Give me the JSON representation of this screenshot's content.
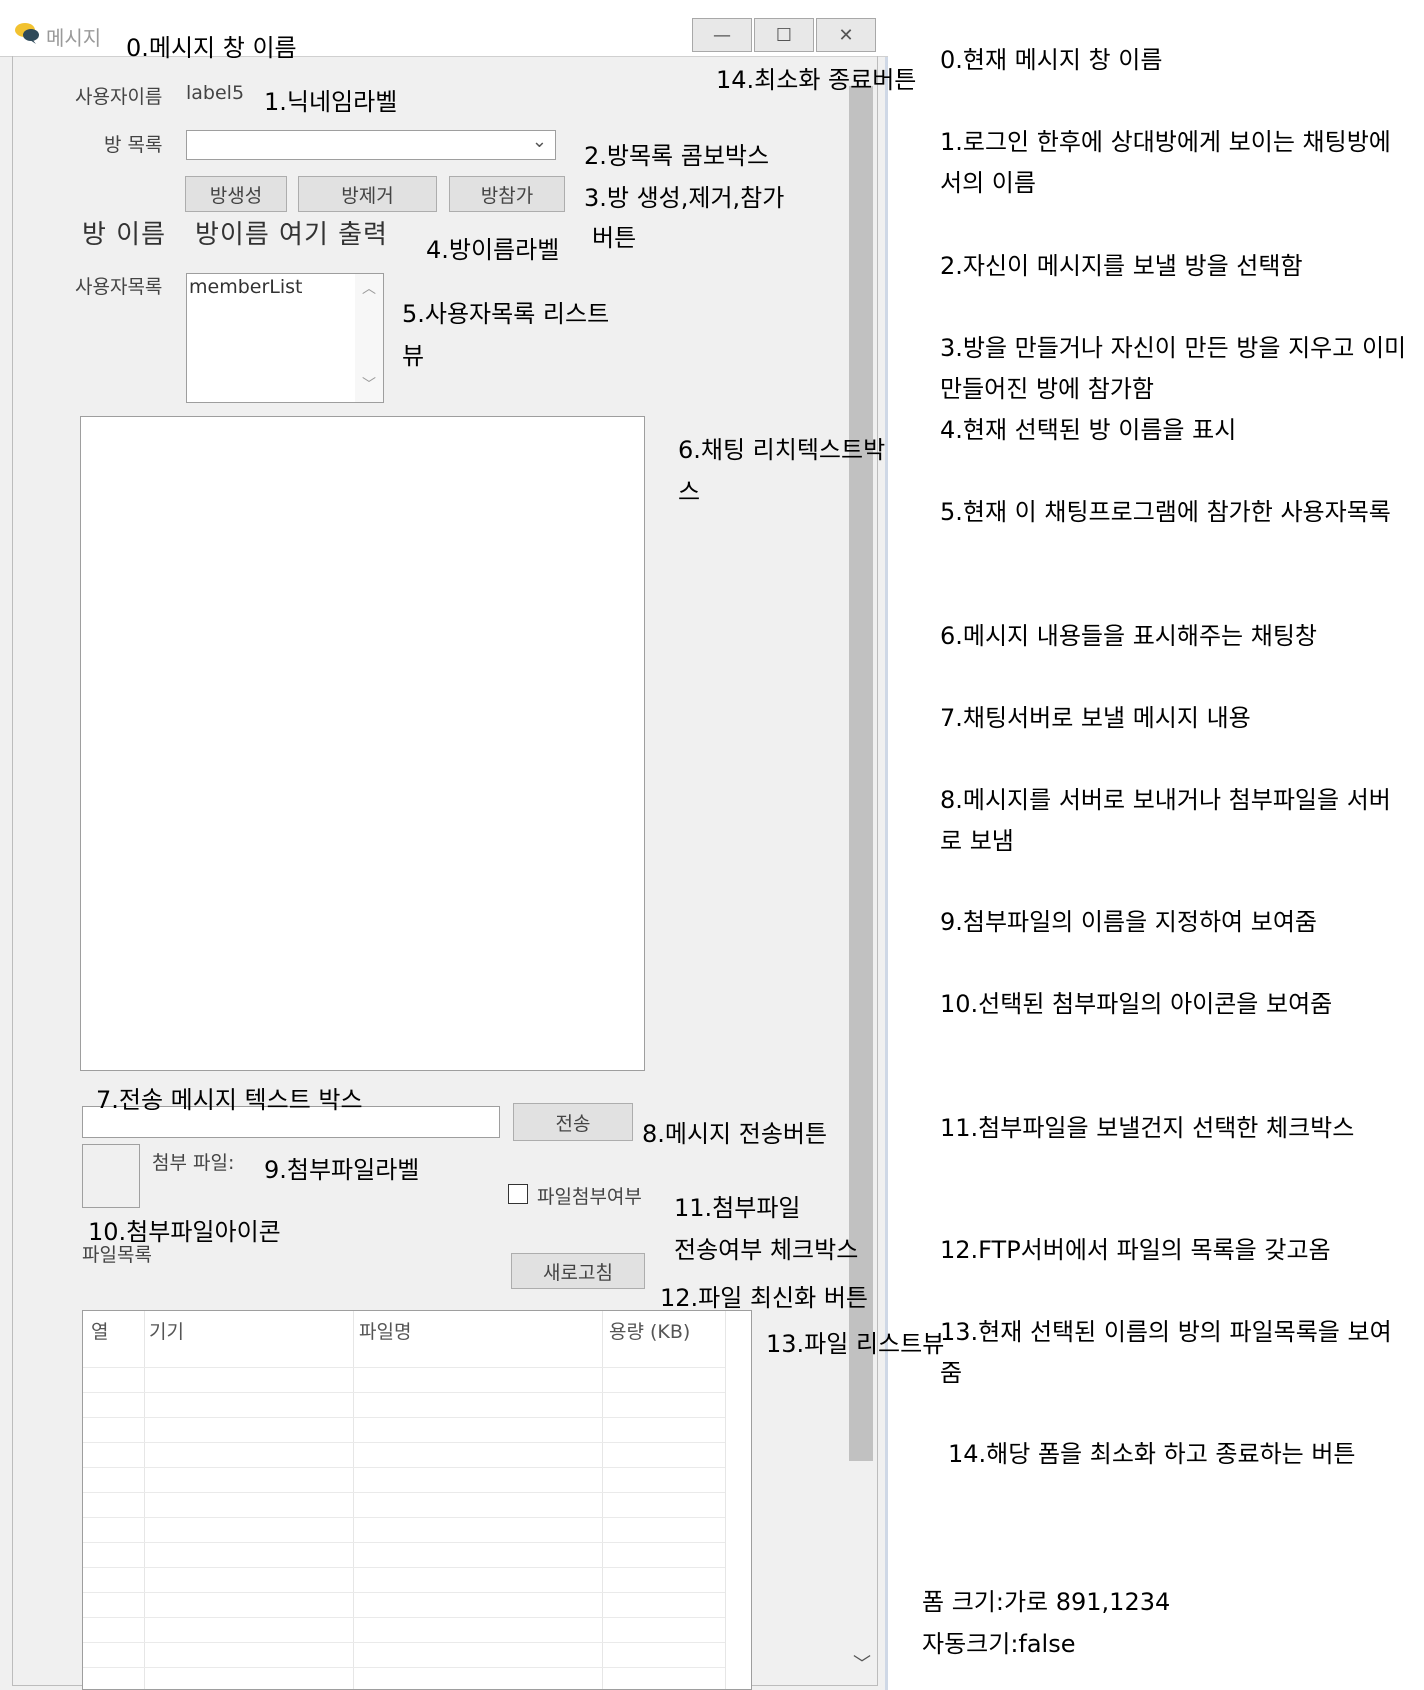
{
  "window": {
    "title": "메시지",
    "minimize_glyph": "—",
    "maximize_glyph": "☐",
    "close_glyph": "✕"
  },
  "form": {
    "username_caption": "사용자이름",
    "username_value": "label5",
    "room_list_caption": "방 목록",
    "combo_arrow": "⌄",
    "buttons": {
      "create": "방생성",
      "remove": "방제거",
      "join": "방참가"
    },
    "room_name_caption": "방 이름",
    "room_name_value": "방이름 여기 출력",
    "user_list_caption": "사용자목록",
    "user_list_item": "memberList",
    "scroll_up": "︿",
    "scroll_down": "﹀",
    "send_button": "전송",
    "attach_caption": "첨부 파일:",
    "attach_checkbox_label": "파일첨부여부",
    "file_list_caption": "파일목록",
    "refresh_button": "새로고침",
    "columns": [
      "열",
      "기기",
      "파일명",
      "용량 (KB)"
    ]
  },
  "annotations": {
    "a0": "0.메시지 창 이름",
    "a1": "1.닉네임라벨",
    "a2": "2.방목록 콤보박스",
    "a3_line1": "3.방 생성,제거,참가",
    "a3_line2": "버튼",
    "a4": "4.방이름라벨",
    "a5_line1": "5.사용자목록 리스트",
    "a5_line2": "뷰",
    "a6_line1": "6.채팅 리치텍스트박",
    "a6_line2": "스",
    "a7": "7.전송 메시지 텍스트 박스",
    "a8": "8.메시지 전송버튼",
    "a9": "9.첨부파일라벨",
    "a10": "10.첨부파일아이콘",
    "a11_line1": "11.첨부파일",
    "a11_line2": "전송여부 체크박스",
    "a12": "12.파일 최신화 버튼",
    "a13": "13.파일 리스트뷰",
    "a14": "14.최소화 종료버튼"
  },
  "descriptions": {
    "d0": "0.현재 메시지 창 이름",
    "d1": "1.로그인 한후에 상대방에게 보이는 채팅방에서의 이름",
    "d2": "2.자신이 메시지를 보낼 방을 선택함",
    "d3": "3.방을 만들거나 자신이 만든 방을 지우고 이미 만들어진 방에 참가함",
    "d4": "4.현재 선택된 방 이름을 표시",
    "d5": "5.현재 이 채팅프로그램에 참가한 사용자목록",
    "d6": "6.메시지 내용들을 표시해주는 채팅창",
    "d7": "7.채팅서버로 보낼 메시지 내용",
    "d8": "8.메시지를 서버로 보내거나 첨부파일을 서버로 보냄",
    "d9": "9.첨부파일의 이름을 지정하여 보여줌",
    "d10": "10.선택된 첨부파일의 아이콘을 보여줌",
    "d11": "11.첨부파일을 보낼건지 선택한 체크박스",
    "d12": "12.FTP서버에서 파일의 목록을 갖고옴",
    "d13": "13.현재 선택된 이름의 방의 파일목록을 보여줌",
    "d14": "14.해당 폼을 최소화 하고 종료하는 버튼",
    "size": "폼 크기:가로 891,1234",
    "autosize": "자동크기:false"
  }
}
